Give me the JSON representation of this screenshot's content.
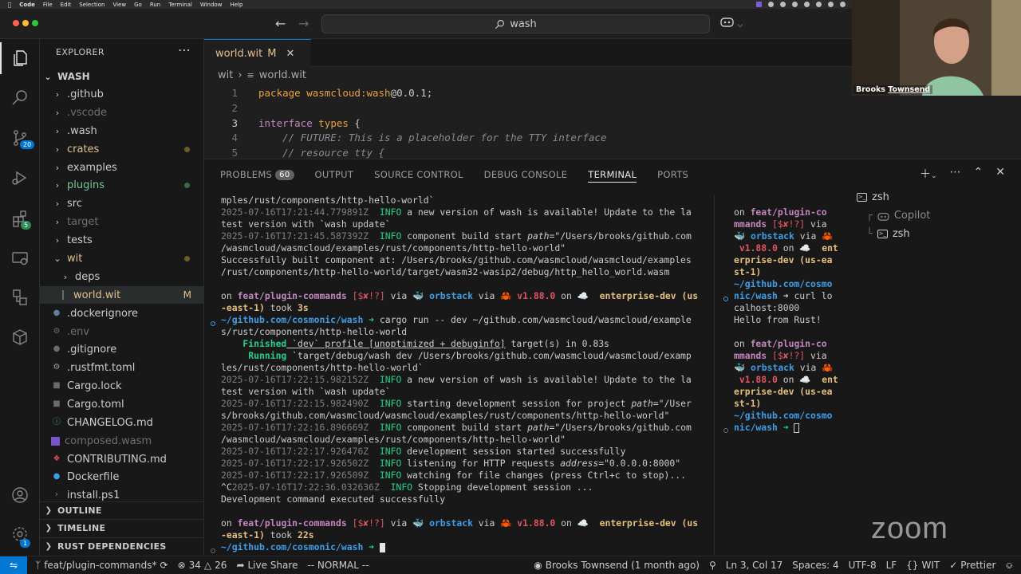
{
  "menubar": {
    "app": "Code",
    "items": [
      "File",
      "Edit",
      "Selection",
      "View",
      "Go",
      "Run",
      "Terminal",
      "Window",
      "Help"
    ]
  },
  "titlebar": {
    "search_text": "wash"
  },
  "activity": {
    "source_control_badge": "20",
    "extensions_badge": "5",
    "accounts_badge": "1"
  },
  "explorer": {
    "title": "EXPLORER",
    "root": "WASH",
    "items": [
      {
        "label": ".github"
      },
      {
        "label": ".vscode"
      },
      {
        "label": ".wash"
      },
      {
        "label": "crates"
      },
      {
        "label": "examples"
      },
      {
        "label": "plugins"
      },
      {
        "label": "src"
      },
      {
        "label": "target"
      },
      {
        "label": "tests"
      },
      {
        "label": "wit"
      },
      {
        "label": "deps"
      },
      {
        "label": "world.wit",
        "mark": "M"
      },
      {
        "label": ".dockerignore"
      },
      {
        "label": ".env"
      },
      {
        "label": ".gitignore"
      },
      {
        "label": ".rustfmt.toml"
      },
      {
        "label": "Cargo.lock"
      },
      {
        "label": "Cargo.toml"
      },
      {
        "label": "CHANGELOG.md"
      },
      {
        "label": "composed.wasm"
      },
      {
        "label": "CONTRIBUTING.md"
      },
      {
        "label": "Dockerfile"
      },
      {
        "label": "install.ps1"
      }
    ],
    "sections": [
      "OUTLINE",
      "TIMELINE",
      "RUST DEPENDENCIES"
    ]
  },
  "editor": {
    "tab": {
      "label": "world.wit",
      "mark": "M"
    },
    "breadcrumb": [
      "wit",
      "world.wit"
    ],
    "lines": [
      {
        "n": "1",
        "a": "package ",
        "b": "wasmcloud:wash",
        "c": "@0.0.1;"
      },
      {
        "n": "2",
        "a": "",
        "b": "",
        "c": ""
      },
      {
        "n": "3",
        "a": "interface ",
        "b": "types",
        "c": " {"
      },
      {
        "n": "4",
        "a": "    // FUTURE: This is a placeholder for the TTY interface",
        "b": "",
        "c": ""
      },
      {
        "n": "5",
        "a": "    // resource tty {",
        "b": "",
        "c": ""
      }
    ]
  },
  "panel": {
    "tabs": {
      "problems": "PROBLEMS",
      "problems_count": "60",
      "output": "OUTPUT",
      "source_control": "SOURCE CONTROL",
      "debug_console": "DEBUG CONSOLE",
      "terminal": "TERMINAL",
      "ports": "PORTS"
    }
  },
  "terminal_main": {
    "l1": "mples/rust/components/http-hello-world`",
    "l2_ts": "2025-07-16T17:21:44.779891Z",
    "l2_lvl": "INFO",
    "l2_msg": " a new version of wash is available! Update to the la",
    "l3": "test version with `wash update`",
    "l4_ts": "2025-07-16T17:21:45.587392Z",
    "l4_lvl": "INFO",
    "l4_msg": " component build start ",
    "l4_key": "path",
    "l4_val": "=\"/Users/brooks/github.com",
    "l5": "/wasmcloud/wasmcloud/examples/rust/components/http-hello-world\"",
    "l6": "Successfully built component at: /Users/brooks/github.com/wasmcloud/wasmcloud/examples",
    "l7": "/rust/components/http-hello-world/target/wasm32-wasip2/debug/http_hello_world.wasm",
    "p1_on": "on ",
    "p1_branch": "feat/plugin-commands",
    "p1_status": " [$✘!?]",
    "p1_via": " via ",
    "p1_ob": "🐳 orbstack",
    "p1_via2": " via ",
    "p1_rust": "🦀 v1.88.0",
    "p1_on2": " on ",
    "p1_aws": "☁️  enterprise-dev (us",
    "p1b_aws": "-east-1)",
    "p1b_took": " took ",
    "p1b_time": "3s",
    "p1c_path": "~/github.com/cosmonic/wash",
    "p1c_arrow": " ➜ ",
    "p1c_cmd": "cargo run -- dev ~/github.com/wasmcloud/wasmcloud/example",
    "p1d": "s/rust/components/http-hello-world",
    "f1_a": "    Finished",
    "f1_b": " `dev` profile [unoptimized + debuginfo]",
    "f1_c": " target(s) in 0.83s",
    "r1_a": "     Running",
    "r1_b": " `target/debug/wash dev /Users/brooks/github.com/wasmcloud/wasmcloud/examp",
    "r2": "les/rust/components/http-hello-world`",
    "i1_ts": "2025-07-16T17:22:15.982152Z",
    "i1_lvl": "INFO",
    "i1_msg": " a new version of wash is available! Update to the la",
    "i1b": "test version with `wash update`",
    "i2_ts": "2025-07-16T17:22:15.982490Z",
    "i2_lvl": "INFO",
    "i2_msg": " starting development session for project ",
    "i2_key": "path",
    "i2_val": "=\"/User",
    "i2b": "s/brooks/github.com/wasmcloud/wasmcloud/examples/rust/components/http-hello-world\"",
    "i3_ts": "2025-07-16T17:22:16.896669Z",
    "i3_lvl": "INFO",
    "i3_msg": " component build start ",
    "i3_key": "path",
    "i3_val": "=\"/Users/brooks/github.com",
    "i3b": "/wasmcloud/wasmcloud/examples/rust/components/http-hello-world\"",
    "i4_ts": "2025-07-16T17:22:17.926476Z",
    "i4_lvl": "INFO",
    "i4_msg": " development session started successfully",
    "i5_ts": "2025-07-16T17:22:17.926502Z",
    "i5_lvl": "INFO",
    "i5_msg": " listening for HTTP requests ",
    "i5_key": "address",
    "i5_val": "=\"0.0.0.0:8000\"",
    "i6_ts": "2025-07-16T17:22:17.926509Z",
    "i6_lvl": "INFO",
    "i6_msg": " watching for file changes (press Ctrl+c to stop)...",
    "i7_pre": "^C",
    "i7_ts": "2025-07-16T17:22:36.032636Z",
    "i7_lvl": "INFO",
    "i7_msg": " Stopping development session ...",
    "done": "Development command executed successfully",
    "p2_on": "on ",
    "p2_branch": "feat/plugin-commands",
    "p2_status": " [$✘!?]",
    "p2_via": " via ",
    "p2_ob": "🐳 orbstack",
    "p2_via2": " via ",
    "p2_rust": "🦀 v1.88.0",
    "p2_on2": " on ",
    "p2_aws": "☁️  enterprise-dev (us",
    "p2b_aws": "-east-1)",
    "p2b_took": " took ",
    "p2b_time": "22s",
    "p2c_path": "~/github.com/cosmonic/wash",
    "p2c_arrow": " ➜ "
  },
  "terminal_side": {
    "a1": "on ",
    "a1_branch": "feat/plugin-co",
    "a2_branch": "mmands",
    "a2_status": " [$✘!?]",
    "a2_via": " via",
    "a3_ob": "🐳 orbstack",
    "a3_via": " via 🦀",
    "a4_rust": " v1.88.0",
    "a4_on": " on ☁️  ",
    "a4_ent": "ent",
    "a5": "erprise-dev (us-ea",
    "a6": "st-1)",
    "a7": "~/github.com/cosmo",
    "a8_path": "nic/wash",
    "a8_cmd": " ➜ curl lo",
    "a9": "calhost:8000",
    "a10": "Hello from Rust!",
    "b1": "on ",
    "b1_branch": "feat/plugin-co",
    "b2_branch": "mmands",
    "b2_status": " [$✘!?]",
    "b2_via": " via",
    "b3_ob": "🐳 orbstack",
    "b3_via": " via 🦀",
    "b4_rust": " v1.88.0",
    "b4_on": " on ☁️  ",
    "b4_ent": "ent",
    "b5": "erprise-dev (us-ea",
    "b6": "st-1)",
    "b7": "~/github.com/cosmo",
    "b8_path": "nic/wash",
    "b8_arrow": " ➜ "
  },
  "terminal_list": {
    "items": [
      "zsh",
      "Copilot",
      "zsh"
    ]
  },
  "statusbar": {
    "branch": "feat/plugin-commands*",
    "errors": "34",
    "warnings": "26",
    "live_share": "Live Share",
    "vim_mode": "-- NORMAL --",
    "blame": "Brooks Townsend (1 month ago)",
    "position": "Ln 3, Col 17",
    "spaces": "Spaces: 4",
    "encoding": "UTF-8",
    "eol": "LF",
    "language": "WIT",
    "formatter": "Prettier"
  },
  "webcam": {
    "name_first": "Brooks",
    "name_last": "Townsend"
  },
  "overlay": {
    "logo": "zoom"
  },
  "colors": {
    "accent": "#0078d4",
    "modified": "#e2c08d",
    "branch": "#c586c0",
    "info": "#23d18b"
  }
}
